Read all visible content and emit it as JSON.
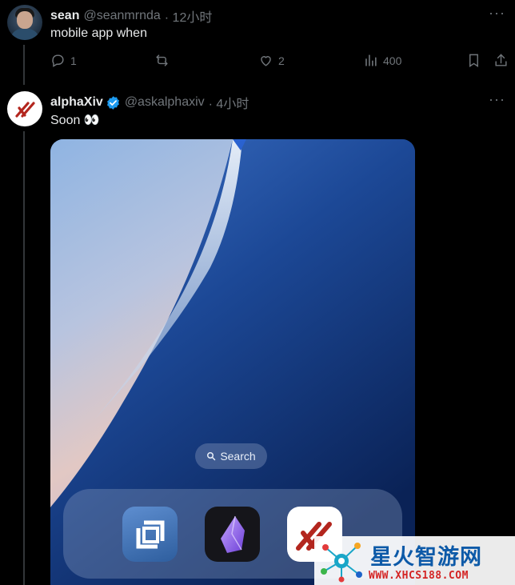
{
  "tweet1": {
    "name": "sean",
    "handle": "@seanmrnda",
    "time": "· 12小时",
    "text": "mobile app when",
    "more_icon": "more-icon",
    "actions": {
      "reply_count": "1",
      "retweet_count": "",
      "like_count": "2",
      "views_count": "400"
    }
  },
  "tweet2": {
    "name": "alphaXiv",
    "handle": "@askalphaxiv",
    "time": "· 4小时",
    "text": "Soon 👀",
    "verified": true,
    "media": {
      "search_label": "Search",
      "dock_apps": [
        "square-app-icon",
        "obsidian-app-icon",
        "alphaxiv-app-icon"
      ]
    }
  },
  "watermark": {
    "title": "星火智游网",
    "url": "WWW.XHCS188.COM"
  },
  "colors": {
    "background": "#000000",
    "text": "#e7e9ea",
    "muted": "#71767b",
    "verified": "#1d9bf0",
    "alpha_red": "#b3261e"
  }
}
